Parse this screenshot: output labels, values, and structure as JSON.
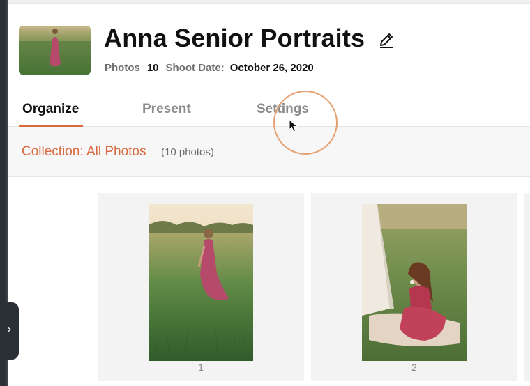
{
  "header": {
    "title": "Anna Senior Portraits",
    "photos_label": "Photos",
    "photos_count": "10",
    "shoot_date_label": "Shoot Date:",
    "shoot_date_value": "October 26, 2020"
  },
  "tabs": [
    {
      "label": "Organize",
      "active": true
    },
    {
      "label": "Present",
      "active": false
    },
    {
      "label": "Settings",
      "active": false
    }
  ],
  "collection": {
    "link_label": "Collection: All Photos",
    "count_label": "(10 photos)"
  },
  "photos": [
    {
      "number": "1"
    },
    {
      "number": "2"
    }
  ],
  "drawer": {
    "toggle_glyph": "›"
  },
  "icons": {
    "edit": "pencil-icon",
    "drawer_toggle": "chevron-right-icon",
    "cursor": "mouse-pointer-icon"
  },
  "colors": {
    "accent": "#d9693f",
    "dark_sidebar": "#2b2f36",
    "muted_text": "#8a8a8a"
  }
}
